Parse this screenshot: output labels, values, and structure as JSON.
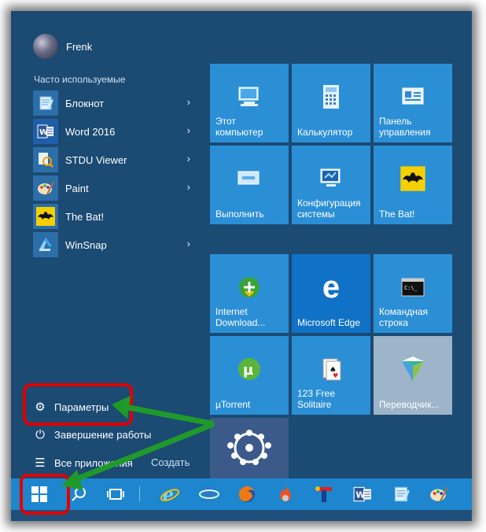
{
  "user": {
    "name": "Frenk"
  },
  "section": {
    "title": "Часто используемые"
  },
  "apps": [
    {
      "label": "Блокнот",
      "icon": "notepad-icon",
      "has_submenu": true
    },
    {
      "label": "Word 2016",
      "icon": "word-icon",
      "has_submenu": true
    },
    {
      "label": "STDU Viewer",
      "icon": "stdu-viewer-icon",
      "has_submenu": true
    },
    {
      "label": "Paint",
      "icon": "paint-palette-icon",
      "has_submenu": true
    },
    {
      "label": "The Bat!",
      "icon": "the-bat-icon",
      "has_submenu": false
    },
    {
      "label": "WinSnap",
      "icon": "winsnap-icon",
      "has_submenu": true
    }
  ],
  "bottom": {
    "settings": "Параметры",
    "shutdown": "Завершение работы",
    "all_apps": "Все приложения",
    "create": "Создать"
  },
  "tiles": {
    "computer": "Этот компьютер",
    "calculator": "Калькулятор",
    "control_panel": "Панель управления",
    "run": "Выполнить",
    "config": "Конфигурация системы",
    "thebat": "The Bat!",
    "idm": "Internet Download...",
    "edge": "Microsoft Edge",
    "cmd": "Командная строка",
    "utorrent": "µTorrent",
    "solitaire": "123 Free Solitaire",
    "translator": "Переводчик..."
  },
  "taskbar": {
    "items": [
      "start-windows-icon",
      "search-icon",
      "task-view-icon",
      "internet-explorer-icon",
      "globe-browser-icon",
      "firefox-icon",
      "burning-app-icon",
      "tool-app-icon",
      "word-icon",
      "notepad-icon",
      "paint-palette-icon"
    ]
  },
  "colors": {
    "menu_bg": "#1b4a73",
    "tile": "#2b8fd6",
    "taskbar": "#1d86cf",
    "highlight": "#e00000",
    "arrow": "#1f9a2a"
  }
}
